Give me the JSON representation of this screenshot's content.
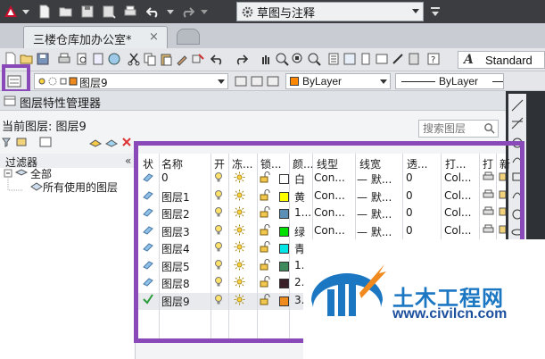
{
  "titlebar": {
    "workspace": "草图与注释"
  },
  "tabs": {
    "file_tab": "三楼仓库加办公室*",
    "close": "×"
  },
  "toolbar": {
    "text_style": "Standard"
  },
  "layer_toolbar": {
    "current_layer": "图层9",
    "color": "ByLayer",
    "linetype": "ByLayer"
  },
  "palette": {
    "title": "图层特性管理器",
    "current_layer_label": "当前图层: 图层9",
    "search_placeholder": "搜索图层",
    "filter_header": "过滤器",
    "filter_collapse": "«",
    "tree": {
      "all": "全部",
      "used": "所有使用的图层"
    }
  },
  "grid": {
    "headers": [
      "状",
      "名称",
      "开",
      "冻...",
      "锁...",
      "颜...",
      "线型",
      "线宽",
      "透...",
      "打...",
      "打",
      "新"
    ],
    "rows": [
      {
        "name": "0",
        "color_name": "白",
        "color_hex": "#ffffff",
        "linetype": "Con...",
        "lineweight": "— 默...",
        "transparency": "0",
        "plot_style": "Col...",
        "current": false
      },
      {
        "name": "图层1",
        "color_name": "黄",
        "color_hex": "#ffff00",
        "linetype": "Con...",
        "lineweight": "— 默...",
        "transparency": "0",
        "plot_style": "Col...",
        "current": false
      },
      {
        "name": "图层2",
        "color_name": "1...",
        "color_hex": "#5b8fb5",
        "linetype": "Con...",
        "lineweight": "— 默...",
        "transparency": "0",
        "plot_style": "Col...",
        "current": false
      },
      {
        "name": "图层3",
        "color_name": "绿",
        "color_hex": "#00e000",
        "linetype": "Con...",
        "lineweight": "— 默...",
        "transparency": "0",
        "plot_style": "Col...",
        "current": false
      },
      {
        "name": "图层4",
        "color_name": "青",
        "color_hex": "#00e6e6",
        "linetype": "",
        "lineweight": "",
        "transparency": "",
        "plot_style": "",
        "current": false
      },
      {
        "name": "图层5",
        "color_name": "1.",
        "color_hex": "#3f8a5c",
        "linetype": "",
        "lineweight": "",
        "transparency": "",
        "plot_style": "",
        "current": false
      },
      {
        "name": "图层8",
        "color_name": "2.",
        "color_hex": "#3a1f28",
        "linetype": "",
        "lineweight": "",
        "transparency": "",
        "plot_style": "",
        "current": false
      },
      {
        "name": "图层9",
        "color_name": "3.",
        "color_hex": "#ef8a1e",
        "linetype": "",
        "lineweight": "",
        "transparency": "",
        "plot_style": "",
        "current": true
      }
    ]
  },
  "watermark": {
    "brand": "土木工程网",
    "url": "www.civilcn.com"
  },
  "colors": {
    "highlight": "#8a49b8",
    "titlebar": "#3b3d41",
    "brand": "#1c77c3"
  }
}
